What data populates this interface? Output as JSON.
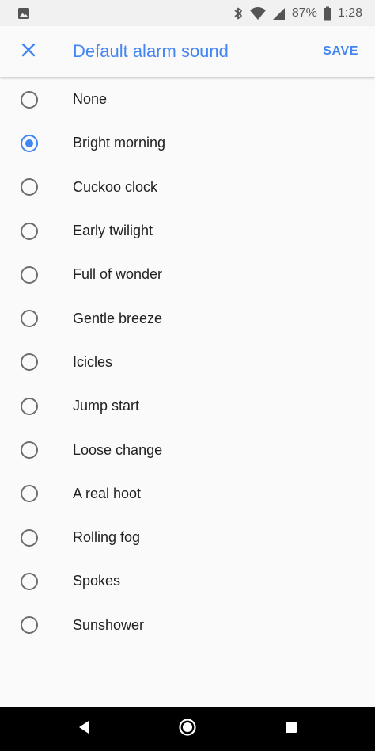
{
  "status_bar": {
    "battery_percent": "87%",
    "time": "1:28",
    "icons": [
      "image-notification-icon",
      "bluetooth-icon",
      "wifi-icon",
      "cellular-signal-icon",
      "battery-icon"
    ]
  },
  "app_bar": {
    "close_icon": "close-icon",
    "title": "Default alarm sound",
    "save_label": "SAVE"
  },
  "sounds": [
    {
      "label": "None",
      "selected": false
    },
    {
      "label": "Bright morning",
      "selected": true
    },
    {
      "label": "Cuckoo clock",
      "selected": false
    },
    {
      "label": "Early twilight",
      "selected": false
    },
    {
      "label": "Full of wonder",
      "selected": false
    },
    {
      "label": "Gentle breeze",
      "selected": false
    },
    {
      "label": "Icicles",
      "selected": false
    },
    {
      "label": "Jump start",
      "selected": false
    },
    {
      "label": "Loose change",
      "selected": false
    },
    {
      "label": "A real hoot",
      "selected": false
    },
    {
      "label": "Rolling fog",
      "selected": false
    },
    {
      "label": "Spokes",
      "selected": false
    },
    {
      "label": "Sunshower",
      "selected": false
    }
  ],
  "nav_bar": {
    "icons": [
      "back-icon",
      "home-icon",
      "recents-icon"
    ]
  },
  "colors": {
    "accent": "#4285f4",
    "status_bar_bg": "#f1f1f1",
    "background": "#fafafa",
    "nav_bar_bg": "#000000"
  }
}
